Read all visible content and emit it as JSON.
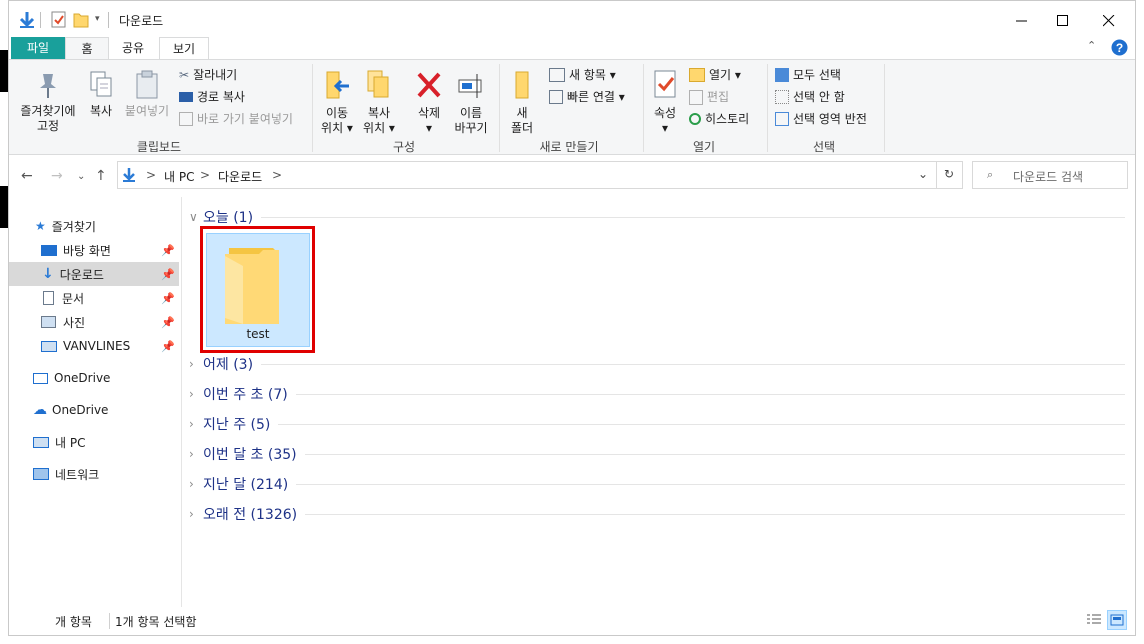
{
  "title": "다운로드",
  "ribbon_tabs": {
    "file": "파일",
    "home": "홈",
    "share": "공유",
    "view": "보기"
  },
  "clipboard": {
    "pin_label": "즐겨찾기에\n고정",
    "copy_label": "복사",
    "paste_label": "붙여넣기",
    "cut_label": "잘라내기",
    "copy_path_label": "경로 복사",
    "paste_shortcut_label": "바로 가기 붙여넣기",
    "group_label": "클립보드"
  },
  "organize": {
    "move_label": "이동\n위치 ▾",
    "copyto_label": "복사\n위치 ▾",
    "delete_label": "삭제\n▾",
    "rename_label": "이름\n바꾸기",
    "group_label": "구성"
  },
  "new": {
    "new_folder_label": "새\n폴더",
    "new_item_label": "새 항목 ▾",
    "easy_access_label": "빠른 연결 ▾",
    "group_label": "새로 만들기"
  },
  "open": {
    "properties_label": "속성\n▾",
    "open_label": "열기 ▾",
    "edit_label": "편집",
    "history_label": "히스토리",
    "group_label": "열기"
  },
  "select": {
    "select_all_label": "모두 선택",
    "select_none_label": "선택 안 함",
    "invert_label": "선택 영역 반전",
    "group_label": "선택"
  },
  "address": {
    "pc": "내 PC",
    "folder": "다운로드",
    "sep": ">"
  },
  "search": {
    "placeholder": "다운로드 검색"
  },
  "nav": {
    "quick_access": "즐겨찾기",
    "desktop": "바탕 화면",
    "downloads": "다운로드",
    "documents": "문서",
    "pictures": "사진",
    "vanvlines": "VANVLINES",
    "onedrive1": "OneDrive",
    "onedrive2": "OneDrive",
    "this_pc": "내 PC",
    "network": "네트워크"
  },
  "groups": [
    {
      "label": "오늘 (1)"
    },
    {
      "label": "어제 (3)"
    },
    {
      "label": "이번 주 초 (7)"
    },
    {
      "label": "지난 주 (5)"
    },
    {
      "label": "이번 달 초 (35)"
    },
    {
      "label": "지난 달 (214)"
    },
    {
      "label": "오래 전 (1326)"
    }
  ],
  "file": {
    "name": "test"
  },
  "status": {
    "count": "개 항목",
    "selected": "1개 항목 선택함"
  },
  "colors": {
    "file_tab": "#19a09b",
    "selection": "#cce8ff",
    "highlight": "#e00000",
    "group_text": "#1e3287"
  }
}
